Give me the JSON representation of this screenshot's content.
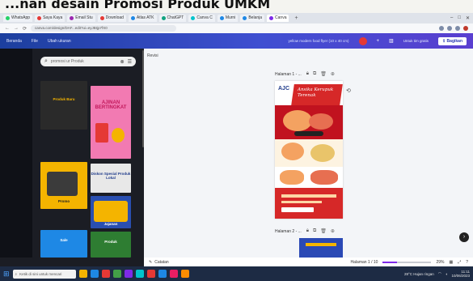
{
  "caption": "...nan desain Promosi Produk UMKM",
  "browser": {
    "tabs": [
      {
        "label": "WhatsApp",
        "color": "#25d366"
      },
      {
        "label": "Saya Kaya",
        "color": "#e53935"
      },
      {
        "label": "Email Stu",
        "color": "#9c27b0"
      },
      {
        "label": "Download",
        "color": "#e53935"
      },
      {
        "label": "Atlas ATK",
        "color": "#1e88e5"
      },
      {
        "label": "ChatGPT",
        "color": "#10a37f"
      },
      {
        "label": "Canva C",
        "color": "#00c4cc"
      },
      {
        "label": "Murni",
        "color": "#1e88e5"
      },
      {
        "label": "Belanja",
        "color": "#1e88e5"
      },
      {
        "label": "Canva",
        "color": "#7d2ae8"
      }
    ],
    "new_tab": "+",
    "url": "canva.com/design/DAF...edit?ui=eyJBIjp7fX0"
  },
  "canva_header": {
    "links": [
      "Beranda",
      "File",
      "Ubah ukuran"
    ],
    "design_title": "yellow modern food flyer (10 x 40 cm)",
    "badge": "Untuk tim gratis",
    "share": "Bagikan"
  },
  "panel": {
    "search_placeholder": "promosi ur Produk",
    "thumbs": [
      {
        "label": "Produk Baru",
        "color": "#2a2a2a"
      },
      {
        "label": "AJINAN BERTINGKAT",
        "color": "#f27ab2"
      },
      {
        "label": "Promo",
        "color": "#f4b400"
      },
      {
        "label": "Diskon Spesial Produk Lokal",
        "color": "#e8e8e8"
      },
      {
        "label": "Jajanan",
        "color": "#2a4fb0"
      },
      {
        "label": "Sale",
        "color": "#1e88e5"
      },
      {
        "label": "Produk",
        "color": "#2e7d32"
      }
    ]
  },
  "canvas": {
    "label": "Revisi",
    "page1": "Halaman 1 - ...",
    "page2": "Halaman 2 - ...",
    "poster_title": "Ansika Kerupuk Terenak",
    "poster_brand": "AJC"
  },
  "bottom": {
    "notes": "Catatan",
    "page_count": "Halaman 1 / 10",
    "zoom": "29%",
    "zoom_fraction": 0.29
  },
  "taskbar": {
    "search": "Ketik di sini untuk mencari",
    "apps": [
      "#f4b400",
      "#1e88e5",
      "#e53935",
      "#43a047",
      "#7d2ae8",
      "#00c4cc",
      "#e53935",
      "#1e88e5",
      "#e91e63",
      "#fb8c00"
    ],
    "weather": "28°C Hujan ringan",
    "time": "11:11",
    "date": "10/06/2023"
  }
}
